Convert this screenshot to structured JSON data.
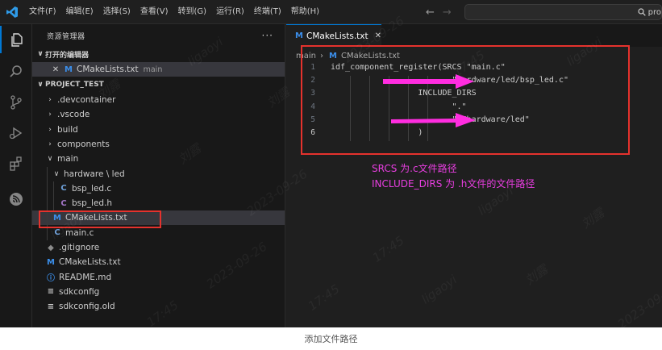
{
  "titlebar": {
    "menu": [
      "文件(F)",
      "编辑(E)",
      "选择(S)",
      "查看(V)",
      "转到(G)",
      "运行(R)",
      "终端(T)",
      "帮助(H)"
    ],
    "search_text": "pro"
  },
  "sidebar": {
    "header": "资源管理器",
    "open_editors_label": "打开的编辑器",
    "open_editor": {
      "name": "CMakeLists.txt",
      "folder": "main"
    },
    "project_label": "PROJECT_TEST",
    "tree": [
      {
        "name": ".devcontainer",
        "type": "folder-collapsed",
        "depth": 1
      },
      {
        "name": ".vscode",
        "type": "folder-collapsed",
        "depth": 1
      },
      {
        "name": "build",
        "type": "folder-collapsed",
        "depth": 1
      },
      {
        "name": "components",
        "type": "folder-collapsed",
        "depth": 1
      },
      {
        "name": "main",
        "type": "folder-open",
        "depth": 1
      },
      {
        "name": "hardware \\ led",
        "type": "folder-open",
        "depth": 2
      },
      {
        "name": "bsp_led.c",
        "type": "c",
        "depth": 3
      },
      {
        "name": "bsp_led.h",
        "type": "h",
        "depth": 3
      },
      {
        "name": "CMakeLists.txt",
        "type": "cmake",
        "depth": 2,
        "selected": true
      },
      {
        "name": "main.c",
        "type": "c",
        "depth": 2
      },
      {
        "name": ".gitignore",
        "type": "git",
        "depth": 1
      },
      {
        "name": "CMakeLists.txt",
        "type": "cmake",
        "depth": 1
      },
      {
        "name": "README.md",
        "type": "info",
        "depth": 1
      },
      {
        "name": "sdkconfig",
        "type": "lines",
        "depth": 1
      },
      {
        "name": "sdkconfig.old",
        "type": "lines",
        "depth": 1
      }
    ]
  },
  "editor": {
    "tab_label": "CMakeLists.txt",
    "breadcrumb": {
      "folder": "main",
      "file": "CMakeLists.txt"
    },
    "lines": [
      {
        "num": "1",
        "text": "idf_component_register(SRCS \"main.c\"",
        "indent": 0
      },
      {
        "num": "2",
        "text": "\"hardware/led/bsp_led.c\"",
        "indent": 25
      },
      {
        "num": "3",
        "text": "INCLUDE_DIRS",
        "indent": 18
      },
      {
        "num": "4",
        "text": "\".\"",
        "indent": 25
      },
      {
        "num": "5",
        "text": "\"./hardware/led\"",
        "indent": 25
      },
      {
        "num": "6",
        "text": ")",
        "indent": 18
      }
    ],
    "current_line": "6",
    "annotations": [
      "SRCS 为.c文件路径",
      "INCLUDE_DIRS 为 .h文件的文件路径"
    ]
  },
  "caption": "添加文件路径",
  "watermarks": [
    "ligaoyi",
    "刘露",
    "2023-09-26",
    "17:45"
  ],
  "colors": {
    "accent": "#0078d4",
    "highlight_box": "#e5322d",
    "arrow": "#ff2de0",
    "annotation": "#e83ee0"
  }
}
